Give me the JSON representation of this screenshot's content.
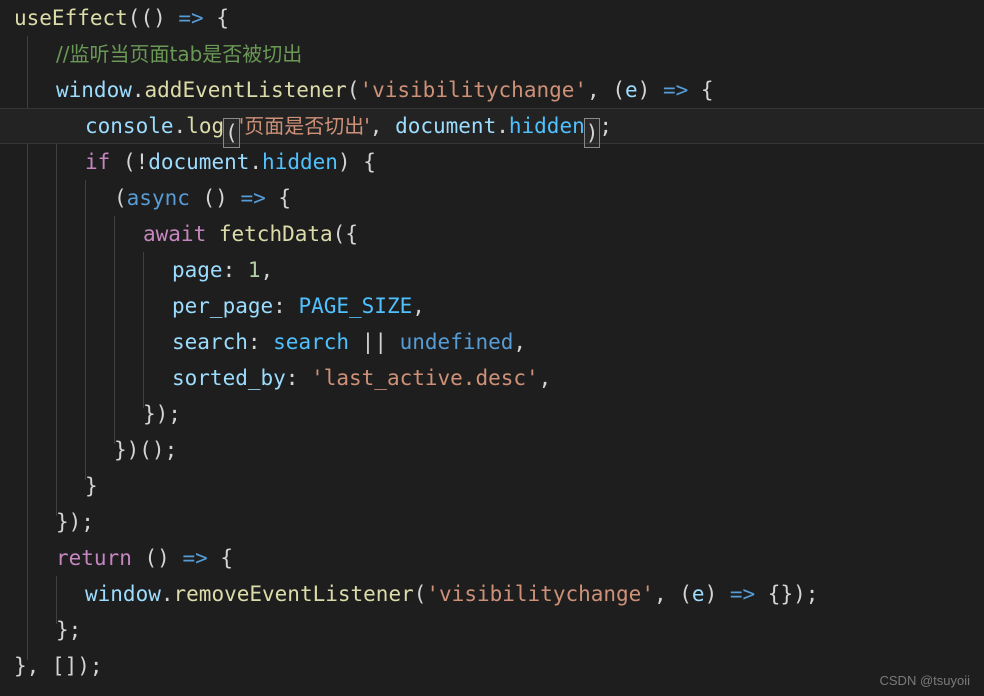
{
  "editor": {
    "theme": "dark-plus",
    "background": "#1e1e1e",
    "active_line_background": "#232323",
    "indent_guide_color": "#404040",
    "font_size_px": 21,
    "line_height_px": 36,
    "language": "javascript"
  },
  "colors": {
    "plain": "#d4d4d4",
    "function": "#dcdcaa",
    "variable": "#9cdcfe",
    "property": "#9cdcfe",
    "identifier": "#4fc1ff",
    "constant": "#569cd6",
    "keyword": "#c586c0",
    "string": "#ce9178",
    "number": "#b5cea8",
    "comment": "#6a9955",
    "arrow": "#569cd6",
    "bracket_match_border": "#888888"
  },
  "code": {
    "full_text": "useEffect(() => {\n  //监听当页面tab是否被切出\n  window.addEventListener('visibilitychange', (e) => {\n    console.log('页面是否切出', document.hidden);\n    if (!document.hidden) {\n      (async () => {\n        await fetchData({\n          page: 1,\n          per_page: PAGE_SIZE,\n          search: search || undefined,\n          sorted_by: 'last_active.desc',\n        });\n      })();\n    }\n  });\n  return () => {\n    window.removeEventListener('visibilitychange', (e) => {});\n  };\n}, []);",
    "active_line_index": 3,
    "lines": [
      {
        "index": 0,
        "indent": 0,
        "text": "useEffect(() => {"
      },
      {
        "index": 1,
        "indent": 1,
        "text": "//监听当页面tab是否被切出"
      },
      {
        "index": 2,
        "indent": 1,
        "text": "window.addEventListener('visibilitychange', (e) => {"
      },
      {
        "index": 3,
        "indent": 2,
        "text": "console.log('页面是否切出', document.hidden);",
        "active": true
      },
      {
        "index": 4,
        "indent": 2,
        "text": "if (!document.hidden) {"
      },
      {
        "index": 5,
        "indent": 3,
        "text": "(async () => {"
      },
      {
        "index": 6,
        "indent": 4,
        "text": "await fetchData({"
      },
      {
        "index": 7,
        "indent": 5,
        "text": "page: 1,"
      },
      {
        "index": 8,
        "indent": 5,
        "text": "per_page: PAGE_SIZE,"
      },
      {
        "index": 9,
        "indent": 5,
        "text": "search: search || undefined,"
      },
      {
        "index": 10,
        "indent": 5,
        "text": "sorted_by: 'last_active.desc',"
      },
      {
        "index": 11,
        "indent": 4,
        "text": "});"
      },
      {
        "index": 12,
        "indent": 3,
        "text": "})();"
      },
      {
        "index": 13,
        "indent": 2,
        "text": "}"
      },
      {
        "index": 14,
        "indent": 1,
        "text": "});"
      },
      {
        "index": 15,
        "indent": 1,
        "text": "return () => {"
      },
      {
        "index": 16,
        "indent": 2,
        "text": "window.removeEventListener('visibilitychange', (e) => {});"
      },
      {
        "index": 17,
        "indent": 1,
        "text": "};"
      },
      {
        "index": 18,
        "indent": 0,
        "text": "}, []);"
      }
    ],
    "tokens": {
      "useEffect": "useEffect",
      "arrow": "=>",
      "comment_line": "//监听当页面tab是否被切出",
      "window": "window",
      "addEventListener": "addEventListener",
      "visibilitychange_str": "'visibilitychange'",
      "e_param": "e",
      "console": "console",
      "log": "log",
      "cn_string": "'页面是否切出'",
      "document": "document",
      "hidden": "hidden",
      "if_kw": "if",
      "async_kw": "async",
      "await_kw": "await",
      "fetchData": "fetchData",
      "page_key": "page",
      "page_value": "1",
      "per_page_key": "per_page",
      "page_size_const": "PAGE_SIZE",
      "search_key": "search",
      "search_value": "search",
      "or_op": "||",
      "undefined_kw": "undefined",
      "sorted_by_key": "sorted_by",
      "sorted_by_value": "'last_active.desc'",
      "return_kw": "return",
      "removeEventListener": "removeEventListener"
    }
  },
  "watermark": {
    "text": "CSDN @tsuyoii"
  }
}
